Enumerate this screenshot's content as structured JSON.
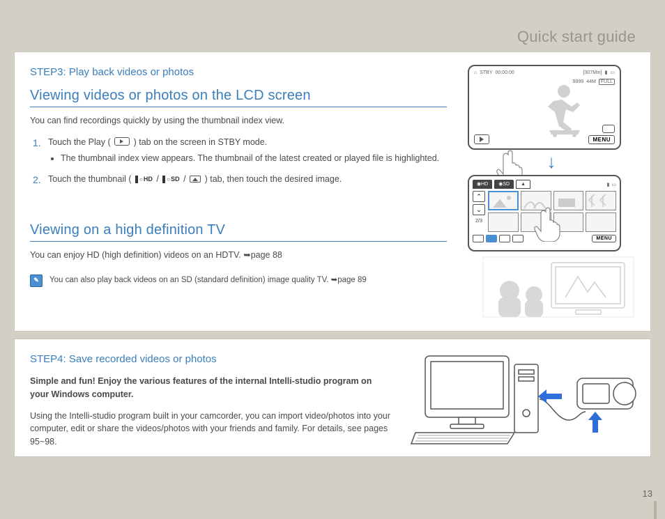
{
  "header": {
    "title": "Quick start guide"
  },
  "page_number": "13",
  "step3": {
    "label": "STEP3: Play back videos or photos",
    "section_a": {
      "title": "Viewing videos or photos on the LCD screen",
      "intro": "You can find recordings quickly by using the thumbnail index view.",
      "item1_pre": "Touch the Play (",
      "item1_post": ") tab on the screen in STBY mode.",
      "item1_bullet": "The thumbnail index view appears. The thumbnail of the latest created or played file is highlighted.",
      "item2_pre": "Touch the thumbnail (",
      "item2_sep1": " /",
      "item2_sep2": " /",
      "item2_post": ") tab, then touch the desired image.",
      "hd_label": "HD",
      "sd_label": "SD"
    },
    "section_b": {
      "title": "Viewing on a high definition TV",
      "text_pre": "You can enjoy HD (high definition) videos on an HDTV. ",
      "text_post": "page 88",
      "note_pre": "You can also play back videos on an SD (standard definition) image quality TV. ",
      "note_post": "page 89"
    },
    "lcd": {
      "stby": "STBY",
      "time": "00:00:00",
      "remain": "[307Min]",
      "counter": "9999",
      "res": "44M",
      "full": "FULL",
      "menu": "MENU",
      "thumb_counter": "2/3"
    }
  },
  "step4": {
    "label": "STEP4: Save recorded videos or photos",
    "bold_text": "Simple and fun! Enjoy the various features of the internal Intelli-studio program on your Windows computer.",
    "body": "Using the Intelli-studio program built in your camcorder, you can import video/photos into your computer, edit or share the videos/photos with your friends and family. For details, see pages 95~98."
  }
}
